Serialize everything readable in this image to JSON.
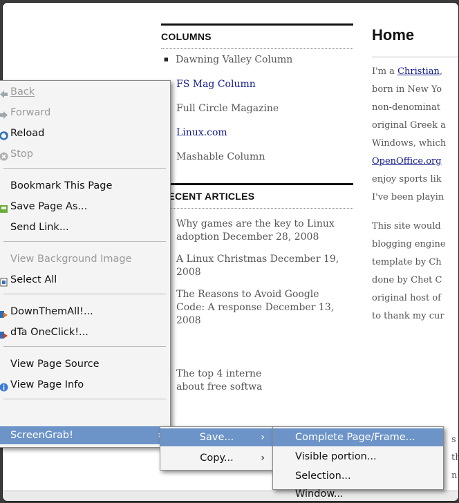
{
  "columns": {
    "title": "COLUMNS",
    "items": [
      {
        "label": "Dawning Valley Column",
        "link": false
      },
      {
        "label": "FS Mag Column",
        "link": true
      },
      {
        "label": "Full Circle Magazine",
        "link": false
      },
      {
        "label": "Linux.com",
        "link": true
      },
      {
        "label": "Mashable Column",
        "link": false
      }
    ]
  },
  "recent": {
    "title": "RECENT ARTICLES",
    "articles": [
      {
        "title": "Why games are the key to Linux adoption",
        "date": "December 28, 2008"
      },
      {
        "title": "A Linux Christmas",
        "date": "December 19, 2008"
      },
      {
        "title": "The Reasons to Avoid Google Code: A response",
        "date": "December 13, 2008"
      },
      {
        "title": "The top 4 interne",
        "date": ""
      },
      {
        "title": "about free softwa",
        "date": ""
      }
    ]
  },
  "home": {
    "title": "Home",
    "p1_lines": [
      "I'm a ",
      "Christian",
      ",",
      "born in New Yo",
      "non-denominat",
      "original Greek a",
      "Windows, which",
      "OpenOffice.org",
      "enjoy sports lik",
      "I've been playin"
    ],
    "p2_lines": [
      "This site would",
      "blogging engine",
      "template by Ch",
      "done by Chet C",
      "original host of",
      "to thank my cur"
    ]
  },
  "context_menu": {
    "items": [
      {
        "label": "Back",
        "mnemonic": "B",
        "disabled": true,
        "icon": "back-arrow-icon"
      },
      {
        "label": "Forward",
        "mnemonic": "F",
        "disabled": true,
        "icon": "forward-arrow-icon"
      },
      {
        "label": "Reload",
        "mnemonic": "R",
        "disabled": false,
        "icon": "reload-icon"
      },
      {
        "label": "Stop",
        "mnemonic": "S",
        "disabled": true,
        "icon": "stop-icon"
      },
      {
        "label": "Bookmark This Page",
        "disabled": false
      },
      {
        "label": "Save Page As...",
        "disabled": false,
        "icon": "save-page-icon"
      },
      {
        "label": "Send Link...",
        "disabled": false
      },
      {
        "label": "View Background Image",
        "disabled": true
      },
      {
        "label": "Select All",
        "disabled": false,
        "icon": "select-all-icon"
      },
      {
        "label": "DownThemAll!...",
        "disabled": false,
        "icon": "downthemall-icon"
      },
      {
        "label": "dTa OneClick!...",
        "disabled": false,
        "icon": "dta-oneclick-icon"
      },
      {
        "label": "View Page Source",
        "disabled": false
      },
      {
        "label": "View Page Info",
        "disabled": false,
        "icon": "info-icon"
      },
      {
        "label": "ScreenGrab!",
        "disabled": false,
        "highlighted": true
      }
    ]
  },
  "screengrab_menu": {
    "items": [
      {
        "label": "Save...",
        "highlighted": true
      },
      {
        "label": "Copy...",
        "highlighted": false
      }
    ]
  },
  "save_menu": {
    "items": [
      {
        "label": "Complete Page/Frame...",
        "highlighted": true
      },
      {
        "label": "Visible portion..."
      },
      {
        "label": "Selection..."
      },
      {
        "label": "Window..."
      }
    ]
  },
  "right_peek": [
    "s",
    "th",
    "n",
    "e"
  ],
  "colors": {
    "highlight": "#6d94c8",
    "link": "#111a8a"
  }
}
